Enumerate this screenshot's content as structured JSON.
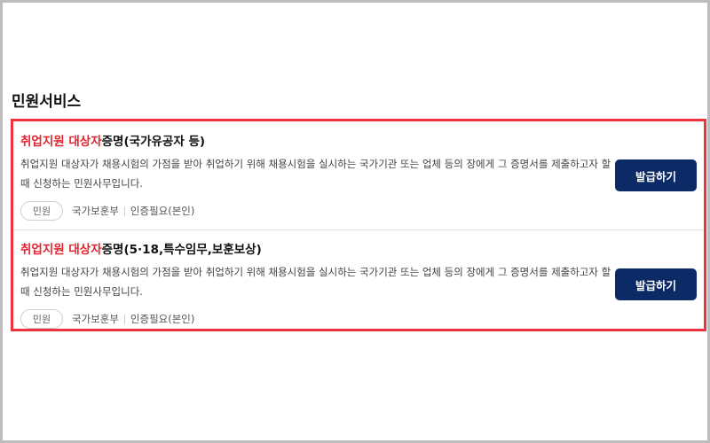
{
  "section": {
    "title": "민원서비스"
  },
  "items": [
    {
      "title_highlight": "취업지원 대상자",
      "title_rest": "증명(국가유공자 등)",
      "description": "취업지원 대상자가 채용시험의 가점을 받아 취업하기 위해 채용시험을 실시하는 국가기관 또는 업체 등의 장에게 그 증명서를 제출하고자 할 때 신청하는 민원사무입니다.",
      "tag": "민원",
      "org": "국가보훈부",
      "auth": "인증필요(본인)",
      "button_label": "발급하기"
    },
    {
      "title_highlight": "취업지원 대상자",
      "title_rest": "증명(5·18,특수임무,보훈보상)",
      "description": "취업지원 대상자가 채용시험의 가점을 받아 취업하기 위해 채용시험을 실시하는 국가기관 또는 업체 등의 장에게 그 증명서를 제출하고자 할 때 신청하는 민원사무입니다.",
      "tag": "민원",
      "org": "국가보훈부",
      "auth": "인증필요(본인)",
      "button_label": "발급하기"
    }
  ],
  "colors": {
    "highlight_red": "#e4242e",
    "list_border": "#ee3340",
    "button_navy": "#0b2a66"
  }
}
